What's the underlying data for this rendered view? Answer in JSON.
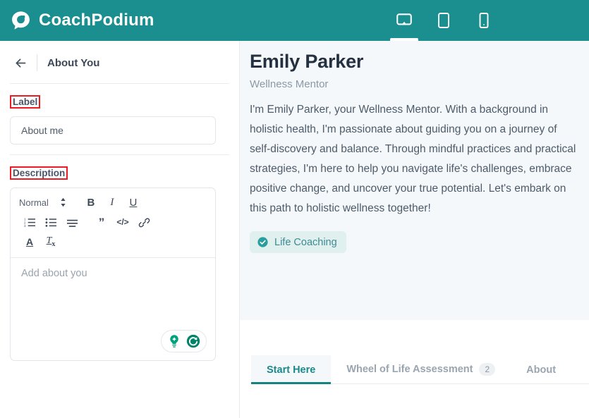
{
  "topbar": {
    "brand_name": "CoachPodium",
    "brand_logo_icon": "speech-bubble-logo",
    "accent_color": "#1b8f8f",
    "devices": [
      {
        "name": "desktop",
        "icon": "desktop-screen-icon",
        "active": true
      },
      {
        "name": "tablet",
        "icon": "tablet-icon",
        "active": false
      },
      {
        "name": "mobile",
        "icon": "mobile-phone-icon",
        "active": false
      }
    ]
  },
  "editor_panel": {
    "back_icon": "arrow-left-icon",
    "title": "About You",
    "label_field": {
      "label": "Label",
      "value": "About me",
      "placeholder": "About me",
      "annotated": true,
      "annotation_color": "#ec1c24"
    },
    "description_field": {
      "label": "Description",
      "placeholder": "Add about you",
      "annotated": true,
      "annotation_color": "#ec1c24"
    },
    "toolbar": {
      "style_select": "Normal",
      "style_select_icon": "chevron-up-down-icon",
      "buttons": [
        {
          "name": "bold",
          "glyph": "B"
        },
        {
          "name": "italic",
          "glyph": "I"
        },
        {
          "name": "underline",
          "glyph": "U"
        },
        {
          "name": "ordered-list",
          "glyph": "list-ordered-icon"
        },
        {
          "name": "bullet-list",
          "glyph": "list-bullet-icon"
        },
        {
          "name": "align",
          "glyph": "align-icon"
        },
        {
          "name": "blockquote",
          "glyph": "quote-icon"
        },
        {
          "name": "code-block",
          "glyph": "code-icon"
        },
        {
          "name": "link",
          "glyph": "link-icon"
        },
        {
          "name": "text-color",
          "glyph": "A"
        },
        {
          "name": "clear-formatting",
          "glyph": "Tx"
        }
      ]
    },
    "ai_actions": [
      {
        "name": "ai-suggest",
        "icon": "lightbulb-icon"
      },
      {
        "name": "ai-regenerate",
        "icon": "refresh-circle-icon"
      }
    ]
  },
  "preview": {
    "name": "Emily Parker",
    "role": "Wellness Mentor",
    "bio": "I'm Emily Parker, your Wellness Mentor. With a background in holistic health, I'm passionate about guiding you on a journey of self-discovery and balance. Through mindful practices and practical strategies, I'm here to help you navigate life's challenges, embrace positive change, and uncover your true potential. Let's embark on this path to holistic wellness together!",
    "badges": [
      {
        "label": "Life Coaching",
        "icon": "check-circle-icon",
        "color": "#3d8a92"
      }
    ],
    "tabs": [
      {
        "label": "Start Here",
        "count": "",
        "active": true
      },
      {
        "label": "Wheel of Life Assessment",
        "count": "2",
        "active": false
      },
      {
        "label": "About",
        "count": "",
        "active": false
      }
    ]
  }
}
